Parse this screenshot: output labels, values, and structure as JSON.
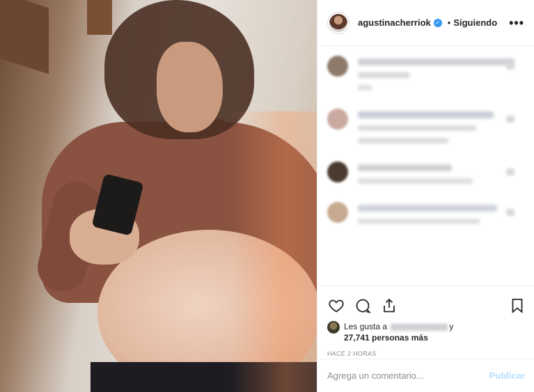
{
  "post": {
    "image_alt": "photo",
    "author": {
      "username": "agustinacherriok",
      "verified_icon": "verified-badge-icon",
      "separator": "•",
      "follow_status": "Siguiendo"
    },
    "more_icon": "more-options-icon",
    "more_label": "•••"
  },
  "comments": [
    {
      "avatar_color": "#8d7a6a",
      "lines": [
        {
          "w": "225",
          "color": "#cfcfd6"
        },
        {
          "w": "75",
          "color": "#d8d8dc"
        },
        {
          "w": "20",
          "color": "#e0e0e0"
        }
      ]
    },
    {
      "avatar_color": "#c9a9a0",
      "lines": [
        {
          "w": "195",
          "color": "#c9cdd8"
        },
        {
          "w": "170",
          "color": "#dcdcdc"
        },
        {
          "w": "130",
          "color": "#dadada"
        }
      ]
    },
    {
      "avatar_color": "#4a3a30",
      "lines": [
        {
          "w": "135",
          "color": "#d0d0d4"
        },
        {
          "w": "165",
          "color": "#dedede"
        }
      ]
    },
    {
      "avatar_color": "#c7aa90",
      "lines": [
        {
          "w": "200",
          "color": "#cfd3dc"
        },
        {
          "w": "175",
          "color": "#dedede"
        }
      ]
    }
  ],
  "actions": {
    "like_icon": "heart-icon",
    "comment_icon": "comment-icon",
    "share_icon": "share-icon",
    "save_icon": "bookmark-icon"
  },
  "likes": {
    "prefix": "Les gusta a",
    "suffix": "y",
    "count_text": "27,741 personas más"
  },
  "timestamp": "HACE 2 HORAS",
  "comment_box": {
    "placeholder": "Agrega un comentario...",
    "publish_label": "Publicar"
  },
  "colors": {
    "accent_blue": "#3897f0",
    "publish_disabled": "#b2dffc",
    "border": "#efefef",
    "muted_text": "#8e8e8e"
  }
}
